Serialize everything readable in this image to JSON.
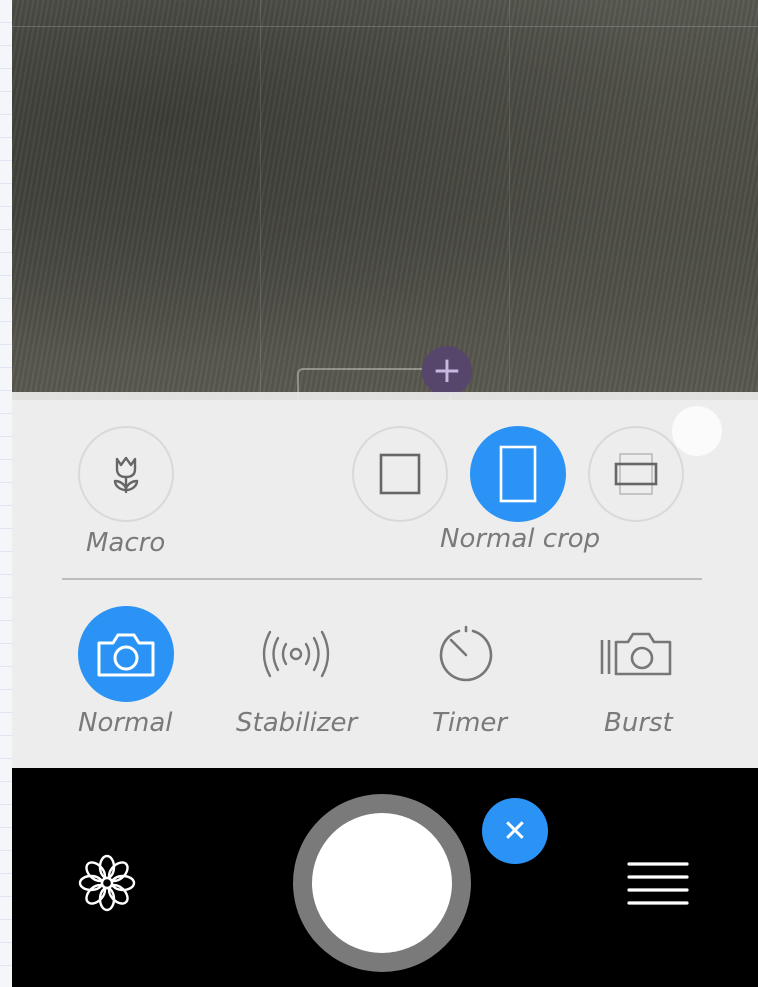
{
  "panel": {
    "macro_label": "Macro",
    "crop_label": "Normal crop"
  },
  "modes": {
    "normal_label": "Normal",
    "stabilizer_label": "Stabilizer",
    "timer_label": "Timer",
    "burst_label": "Burst"
  },
  "bottom_bar": {
    "close_symbol": "✕"
  },
  "focus": {
    "plus_symbol": "+"
  },
  "colors": {
    "accent": "#2a93f5",
    "bar": "#000000"
  },
  "icons": {
    "macro": "tulip-icon",
    "crop_square": "square-crop-icon",
    "crop_portrait": "portrait-crop-icon",
    "crop_landscape": "landscape-crop-icon",
    "normal": "camera-icon",
    "stabilizer": "stabilizer-icon",
    "timer": "timer-icon",
    "burst": "burst-icon",
    "filter": "flower-icon",
    "menu": "menu-icon"
  }
}
